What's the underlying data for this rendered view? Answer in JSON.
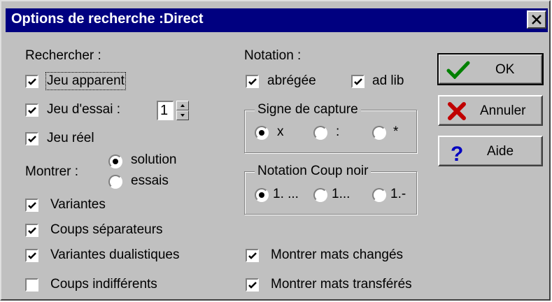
{
  "window": {
    "title": "Options de recherche :Direct"
  },
  "left": {
    "rechercher_label": "Rechercher :",
    "jeu_apparent": {
      "label": "Jeu apparent",
      "checked": true
    },
    "jeu_essai": {
      "label": "Jeu d'essai :",
      "checked": true,
      "value": "1"
    },
    "jeu_reel": {
      "label": "Jeu réel",
      "checked": true
    },
    "montrer_label": "Montrer :",
    "montrer_solution": {
      "label": "solution",
      "selected": true
    },
    "montrer_essais": {
      "label": "essais",
      "selected": false
    },
    "variantes": {
      "label": "Variantes",
      "checked": true
    },
    "coups_separateurs": {
      "label": "Coups séparateurs",
      "checked": true
    },
    "variantes_dualistiques": {
      "label": "Variantes dualistiques",
      "checked": true
    },
    "coups_indifferents": {
      "label": "Coups indifférents",
      "checked": false
    }
  },
  "middle": {
    "notation_label": "Notation :",
    "abregee": {
      "label": "abrégée",
      "checked": true
    },
    "ad_lib": {
      "label": "ad lib",
      "checked": true
    },
    "signe_capture": {
      "title": "Signe de capture",
      "options": [
        {
          "label": "x",
          "selected": true
        },
        {
          "label": ":",
          "selected": false
        },
        {
          "label": "*",
          "selected": false
        }
      ]
    },
    "notation_coup_noir": {
      "title": "Notation Coup noir",
      "options": [
        {
          "label": "1. ...",
          "selected": true
        },
        {
          "label": "1...",
          "selected": false
        },
        {
          "label": "1.-",
          "selected": false
        }
      ]
    },
    "montrer_mats_changes": {
      "label": "Montrer mats changés",
      "checked": true
    },
    "montrer_mats_transferes": {
      "label": "Montrer mats transférés",
      "checked": true
    }
  },
  "buttons": {
    "ok": "OK",
    "annuler": "Annuler",
    "aide": "Aide"
  },
  "colors": {
    "titlebar": "#000080",
    "face": "#c0c0c0",
    "ok_icon": "#008000",
    "cancel_icon": "#c00000",
    "help_icon": "#0000c0"
  }
}
